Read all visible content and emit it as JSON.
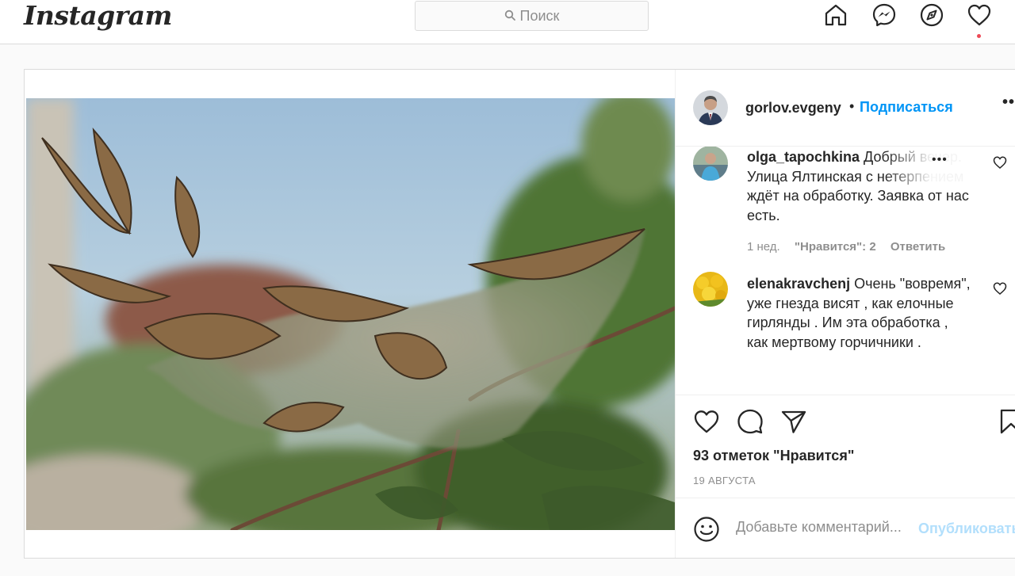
{
  "app": {
    "logo_text": "Instagram"
  },
  "search": {
    "placeholder": "Поиск"
  },
  "nav": {
    "icons": [
      "home-icon",
      "messenger-icon",
      "explore-icon",
      "activity-heart-icon"
    ],
    "notification_color": "#ed4956"
  },
  "post": {
    "author": {
      "username": "gorlov.evgeny",
      "separator": "•",
      "follow_label": "Подписаться",
      "more_label": "••"
    },
    "comments": [
      {
        "username": "olga_tapochkina",
        "text": "Добрый вечер. Улица Ялтинская с нетерпением ждёт на обработку. Заявка от нас есть.",
        "time": "1 нед.",
        "likes": "\"Нравится\": 2",
        "reply": "Ответить",
        "more": "•••"
      },
      {
        "username": "elenakravchenj",
        "text": "Очень \"вовремя\", уже гнезда висят , как елочные гирлянды . Им эта обработка , как мертвому горчичники ."
      }
    ],
    "likes_text": "93 отметок \"Нравится\"",
    "date": "19 АВГУСТА",
    "add_comment": {
      "placeholder": "Добавьте комментарий...",
      "publish_label": "Опубликовать"
    }
  },
  "colors": {
    "link_blue": "#0095f6",
    "publish_disabled": "#b2dffc",
    "muted": "#8e8e8e",
    "border": "#dbdbdb"
  }
}
